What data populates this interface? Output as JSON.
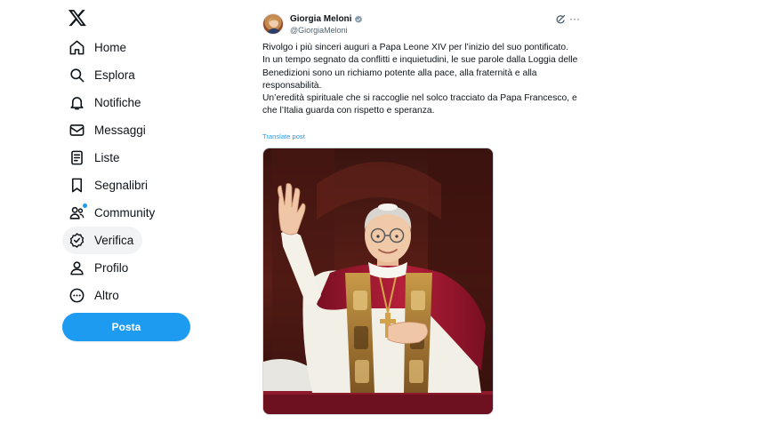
{
  "sidebar": {
    "logo": "x-logo-icon",
    "items": [
      {
        "label": "Home",
        "icon": "home-icon"
      },
      {
        "label": "Esplora",
        "icon": "search-icon"
      },
      {
        "label": "Notifiche",
        "icon": "bell-icon"
      },
      {
        "label": "Messaggi",
        "icon": "envelope-icon"
      },
      {
        "label": "Liste",
        "icon": "list-icon"
      },
      {
        "label": "Segnalibri",
        "icon": "bookmark-icon"
      },
      {
        "label": "Community",
        "icon": "community-icon"
      },
      {
        "label": "Verifica",
        "icon": "verified-icon"
      },
      {
        "label": "Profilo",
        "icon": "person-icon"
      },
      {
        "label": "Altro",
        "icon": "more-circle-icon"
      }
    ],
    "post_label": "Posta",
    "accent_color": "#1d9bf0"
  },
  "tweet": {
    "author_name": "Giorgia Meloni",
    "author_handle": "@GiorgiaMeloni",
    "paragraphs": [
      "Rivolgo i più sinceri auguri a Papa Leone XIV per l’inizio del suo pontificato.",
      "In un tempo segnato da conflitti e inquietudini, le sue parole dalla Loggia delle Benedizioni sono un richiamo potente alla pace, alla fraternità e alla responsabilità.",
      "Un’eredità spirituale che si raccoglie nel solco tracciato da Papa Francesco, e che l’Italia guarda con rispetto e speranza."
    ],
    "translate_label": "Translate post"
  }
}
